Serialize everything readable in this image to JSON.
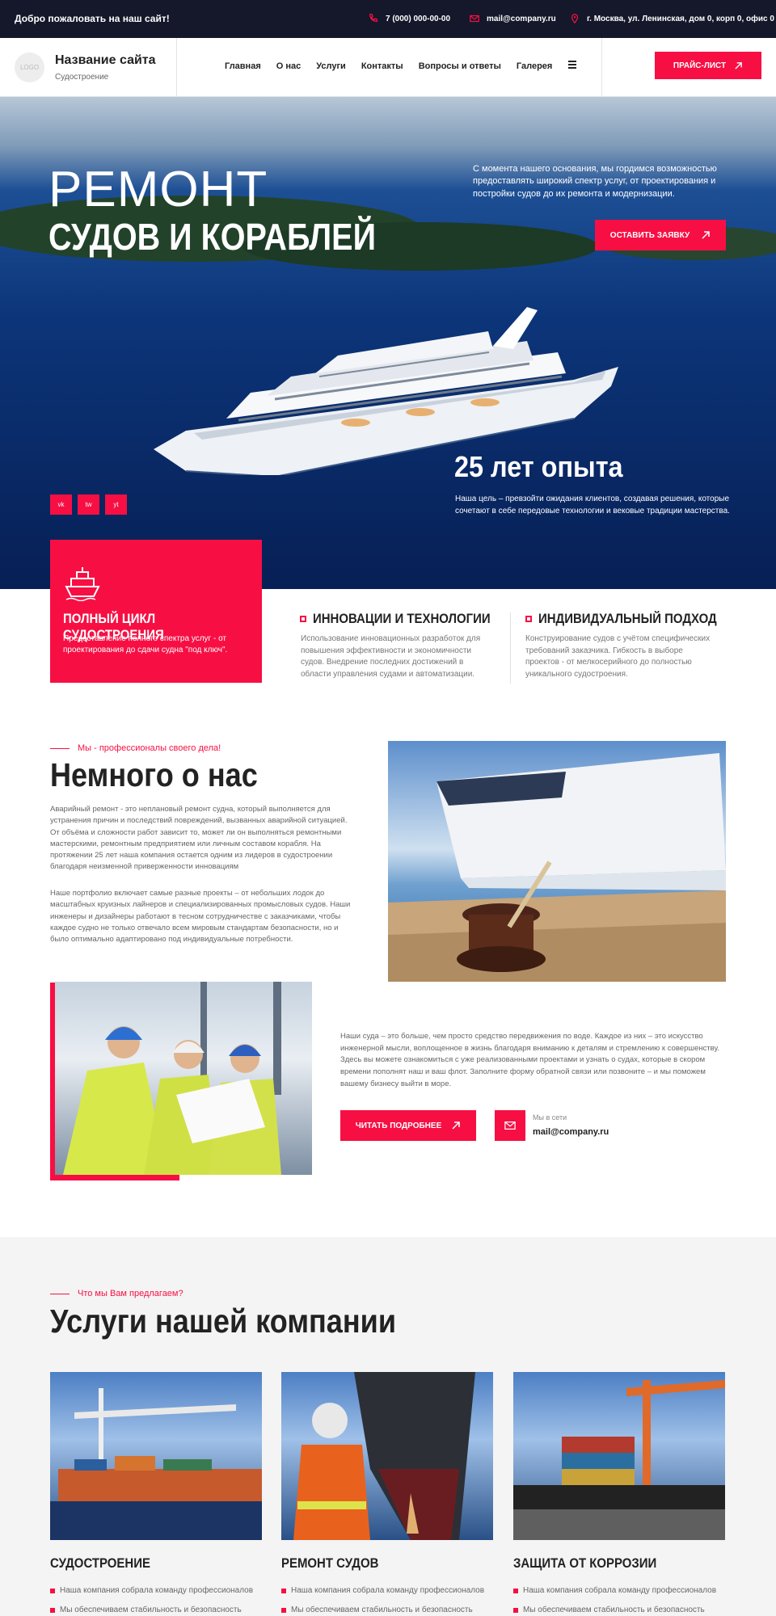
{
  "topbar": {
    "welcome": "Добро пожаловать на наш сайт!",
    "phone": "7 (000) 000-00-00",
    "email": "mail@company.ru",
    "address": "г. Москва, ул. Ленинская, дом 0, корп 0, офис 0"
  },
  "header": {
    "logo": "LOGO",
    "site_name": "Название сайта",
    "site_sub": "Судостроение",
    "nav": [
      "Главная",
      "О нас",
      "Услуги",
      "Контакты",
      "Вопросы и ответы",
      "Галерея"
    ],
    "price_button": "ПРАЙС-ЛИСТ"
  },
  "hero": {
    "title_line1": "РЕМОНТ",
    "title_line2": "СУДОВ И КОРАБЛЕЙ",
    "text": "С момента нашего основания, мы гордимся возможностью предоставлять широкий спектр услуг, от проектирования и постройки судов до их ремонта и модернизации.",
    "button": "ОСТАВИТЬ ЗАЯВКУ",
    "experience": "25 лет опыта",
    "experience_text": "Наша цель – превзойти ожидания клиентов, создавая решения, которые сочетают в себе передовые технологии и вековые традиции мастерства.",
    "social": [
      "vk",
      "tw",
      "yt"
    ]
  },
  "features": [
    {
      "title": "ПОЛНЫЙ ЦИКЛ СУДОСТРОЕНИЯ",
      "text": "Предоставление полного спектра услуг - от проектирования до сдачи судна \"под ключ\"."
    },
    {
      "title": "ИННОВАЦИИ И ТЕХНОЛОГИИ",
      "text": "Использование инновационных разработок для повышения эффективности и экономичности судов. Внедрение последних достижений в области управления судами и автоматизации."
    },
    {
      "title": "ИНДИВИДУАЛЬНЫЙ ПОДХОД",
      "text": "Конструирование судов с учётом специфических требований заказчика. Гибкость в выборе проектов - от мелкосерийного до полностью уникального судостроения."
    }
  ],
  "about": {
    "eyebrow": "Мы - профессионалы своего дела!",
    "title": "Немного о нас",
    "p1": "Аварийный ремонт - это неплановый ремонт судна, который выполняется для устранения причин и последствий повреждений, вызванных аварийной ситуацией. От объёма и сложности работ зависит то, может ли он выполняться ремонтными мастерскими, ремонтным предприятием или личным составом корабля. На протяжении 25 лет наша компания остается одним из лидеров в судостроении благодаря неизменной приверженности инновациям",
    "p2": "Наше портфолио включает самые разные проекты – от небольших лодок до масштабных круизных лайнеров и специализированных промысловых судов. Наши инженеры и дизайнеры работают в тесном сотрудничестве с заказчиками, чтобы каждое судно не только отвечало всем мировым стандартам безопасности, но и было оптимально адаптировано под индивидуальные потребности.",
    "p3": "Наши суда – это больше, чем просто средство передвижения по воде. Каждое из них – это искусство инженерной мысли, воплощенное в жизнь благодаря вниманию к деталям и стремлению к совершенству. Здесь вы можете ознакомиться с уже реализованными проектами и узнать о судах, которые в скором времени пополнят наш и ваш флот. Заполните форму обратной связи или позвоните – и мы поможем вашему бизнесу выйти в море.",
    "read_more": "ЧИТАТЬ ПОДРОБНЕЕ",
    "online_label": "Мы в сети",
    "online_email": "mail@company.ru"
  },
  "services": {
    "eyebrow": "Что мы Вам предлагаем?",
    "title": "Услуги нашей компании",
    "cards": [
      {
        "title": "СУДОСТРОЕНИЕ",
        "items": [
          "Наша компания собрала команду профессионалов",
          "Мы обеспечиваем стабильность и безопасность"
        ]
      },
      {
        "title": "РЕМОНТ СУДОВ",
        "items": [
          "Наша компания собрала команду профессионалов",
          "Мы обеспечиваем стабильность и безопасность"
        ]
      },
      {
        "title": "ЗАЩИТА ОТ КОРРОЗИИ",
        "items": [
          "Наша компания собрала команду профессионалов",
          "Мы обеспечиваем стабильность и безопасность"
        ]
      }
    ]
  },
  "colors": {
    "accent": "#f70f43",
    "dark": "#15182a"
  }
}
